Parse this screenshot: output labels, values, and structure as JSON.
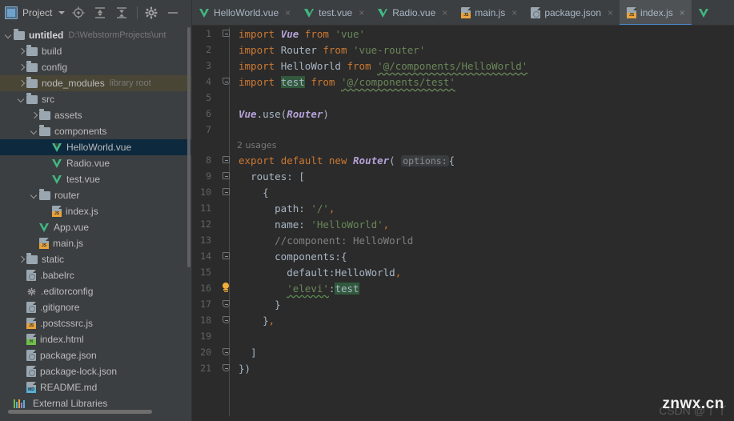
{
  "window": {
    "theme_bg": "#3c3f41",
    "editor_bg": "#2b2b2b",
    "accent": "#4a88c7"
  },
  "project_toolbar": {
    "title": "Project",
    "icons": [
      {
        "name": "project-view-icon",
        "glyph": "project"
      },
      {
        "name": "chevron-down-icon",
        "glyph": "caret-down"
      },
      {
        "name": "locate-file-icon",
        "glyph": "target"
      },
      {
        "name": "expand-all-icon",
        "glyph": "expand"
      },
      {
        "name": "collapse-all-icon",
        "glyph": "collapse"
      },
      {
        "name": "settings-gear-icon",
        "glyph": "gear"
      },
      {
        "name": "hide-panel-icon",
        "glyph": "minus"
      }
    ]
  },
  "tabs": [
    {
      "label": "HelloWorld.vue",
      "icon": "vue",
      "active": false,
      "close": "×"
    },
    {
      "label": "test.vue",
      "icon": "vue",
      "active": false,
      "close": "×"
    },
    {
      "label": "Radio.vue",
      "icon": "vue",
      "active": false,
      "close": "×"
    },
    {
      "label": "main.js",
      "icon": "js",
      "active": false,
      "close": "×"
    },
    {
      "label": "package.json",
      "icon": "json",
      "active": false,
      "close": "×"
    },
    {
      "label": "index.js",
      "icon": "js",
      "active": true,
      "close": "×"
    },
    {
      "label": "",
      "icon": "vue",
      "active": false,
      "close": ""
    }
  ],
  "tree": [
    {
      "label": "untitled",
      "meta": "D:\\WebstormProjects\\unt",
      "type": "folder",
      "indent": 0,
      "arrow": "down",
      "bold": true,
      "state": "normal"
    },
    {
      "label": "build",
      "meta": "",
      "type": "folder",
      "indent": 1,
      "arrow": "right",
      "bold": false,
      "state": "normal"
    },
    {
      "label": "config",
      "meta": "",
      "type": "folder",
      "indent": 1,
      "arrow": "right",
      "bold": false,
      "state": "normal"
    },
    {
      "label": "node_modules",
      "meta": "library root",
      "type": "folder",
      "indent": 1,
      "arrow": "right",
      "bold": false,
      "state": "highlight"
    },
    {
      "label": "src",
      "meta": "",
      "type": "folder",
      "indent": 1,
      "arrow": "down",
      "bold": false,
      "state": "normal"
    },
    {
      "label": "assets",
      "meta": "",
      "type": "folder",
      "indent": 2,
      "arrow": "right",
      "bold": false,
      "state": "normal"
    },
    {
      "label": "components",
      "meta": "",
      "type": "folder",
      "indent": 2,
      "arrow": "down",
      "bold": false,
      "state": "normal"
    },
    {
      "label": "HelloWorld.vue",
      "meta": "",
      "type": "vue",
      "indent": 3,
      "arrow": "none",
      "bold": false,
      "state": "selected"
    },
    {
      "label": "Radio.vue",
      "meta": "",
      "type": "vue",
      "indent": 3,
      "arrow": "none",
      "bold": false,
      "state": "normal"
    },
    {
      "label": "test.vue",
      "meta": "",
      "type": "vue",
      "indent": 3,
      "arrow": "none",
      "bold": false,
      "state": "normal"
    },
    {
      "label": "router",
      "meta": "",
      "type": "folder",
      "indent": 2,
      "arrow": "down",
      "bold": false,
      "state": "normal"
    },
    {
      "label": "index.js",
      "meta": "",
      "type": "js",
      "indent": 3,
      "arrow": "none",
      "bold": false,
      "state": "normal"
    },
    {
      "label": "App.vue",
      "meta": "",
      "type": "vue",
      "indent": 2,
      "arrow": "none",
      "bold": false,
      "state": "normal"
    },
    {
      "label": "main.js",
      "meta": "",
      "type": "js",
      "indent": 2,
      "arrow": "none",
      "bold": false,
      "state": "normal"
    },
    {
      "label": "static",
      "meta": "",
      "type": "folder",
      "indent": 1,
      "arrow": "right",
      "bold": false,
      "state": "normal"
    },
    {
      "label": ".babelrc",
      "meta": "",
      "type": "plain",
      "indent": 1,
      "arrow": "none",
      "bold": false,
      "state": "normal"
    },
    {
      "label": ".editorconfig",
      "meta": "",
      "type": "gear",
      "indent": 1,
      "arrow": "none",
      "bold": false,
      "state": "normal"
    },
    {
      "label": ".gitignore",
      "meta": "",
      "type": "plain",
      "indent": 1,
      "arrow": "none",
      "bold": false,
      "state": "normal"
    },
    {
      "label": ".postcssrc.js",
      "meta": "",
      "type": "js",
      "indent": 1,
      "arrow": "none",
      "bold": false,
      "state": "normal"
    },
    {
      "label": "index.html",
      "meta": "",
      "type": "html",
      "indent": 1,
      "arrow": "none",
      "bold": false,
      "state": "normal"
    },
    {
      "label": "package.json",
      "meta": "",
      "type": "json",
      "indent": 1,
      "arrow": "none",
      "bold": false,
      "state": "normal"
    },
    {
      "label": "package-lock.json",
      "meta": "",
      "type": "json",
      "indent": 1,
      "arrow": "none",
      "bold": false,
      "state": "normal"
    },
    {
      "label": "README.md",
      "meta": "",
      "type": "md",
      "indent": 1,
      "arrow": "none",
      "bold": false,
      "state": "normal"
    },
    {
      "label": "External Libraries",
      "meta": "",
      "type": "extlib",
      "indent": 0,
      "arrow": "none",
      "bold": false,
      "state": "normal"
    }
  ],
  "editor": {
    "filename": "index.js",
    "inlay_usages": "2 usages",
    "param_hint_options": "options:",
    "lines": [
      {
        "n": "1",
        "fold": "top",
        "bulb": false,
        "text": "import Vue from 'vue'"
      },
      {
        "n": "2",
        "fold": "none",
        "bulb": false,
        "text": "import Router from 'vue-router'"
      },
      {
        "n": "3",
        "fold": "none",
        "bulb": false,
        "text": "import HelloWorld from '@/components/HelloWorld'"
      },
      {
        "n": "4",
        "fold": "bottom",
        "bulb": false,
        "text": "import test from '@/components/test'"
      },
      {
        "n": "5",
        "fold": "none",
        "bulb": false,
        "text": ""
      },
      {
        "n": "6",
        "fold": "none",
        "bulb": false,
        "text": "Vue.use(Router)"
      },
      {
        "n": "7",
        "fold": "none",
        "bulb": false,
        "text": ""
      },
      {
        "n": "8",
        "fold": "top",
        "bulb": false,
        "text": "export default new Router( options: {"
      },
      {
        "n": "9",
        "fold": "top",
        "bulb": false,
        "text": "  routes: ["
      },
      {
        "n": "10",
        "fold": "top",
        "bulb": false,
        "text": "    {"
      },
      {
        "n": "11",
        "fold": "none",
        "bulb": false,
        "text": "      path: '/',"
      },
      {
        "n": "12",
        "fold": "none",
        "bulb": false,
        "text": "      name: 'HelloWorld',"
      },
      {
        "n": "13",
        "fold": "none",
        "bulb": false,
        "text": "      //component: HelloWorld"
      },
      {
        "n": "14",
        "fold": "top",
        "bulb": false,
        "text": "      components:{"
      },
      {
        "n": "15",
        "fold": "none",
        "bulb": false,
        "text": "        default:HelloWorld,"
      },
      {
        "n": "16",
        "fold": "none",
        "bulb": true,
        "text": "        'elevi':test"
      },
      {
        "n": "17",
        "fold": "bottom",
        "bulb": false,
        "text": "      }"
      },
      {
        "n": "18",
        "fold": "bottom",
        "bulb": false,
        "text": "    },"
      },
      {
        "n": "19",
        "fold": "none",
        "bulb": false,
        "text": ""
      },
      {
        "n": "20",
        "fold": "bottom",
        "bulb": false,
        "text": "  ]"
      },
      {
        "n": "21",
        "fold": "bottom",
        "bulb": false,
        "text": "})"
      }
    ]
  },
  "watermark": {
    "primary": "znwx.cn",
    "secondary": "CSDN @丫丫"
  }
}
